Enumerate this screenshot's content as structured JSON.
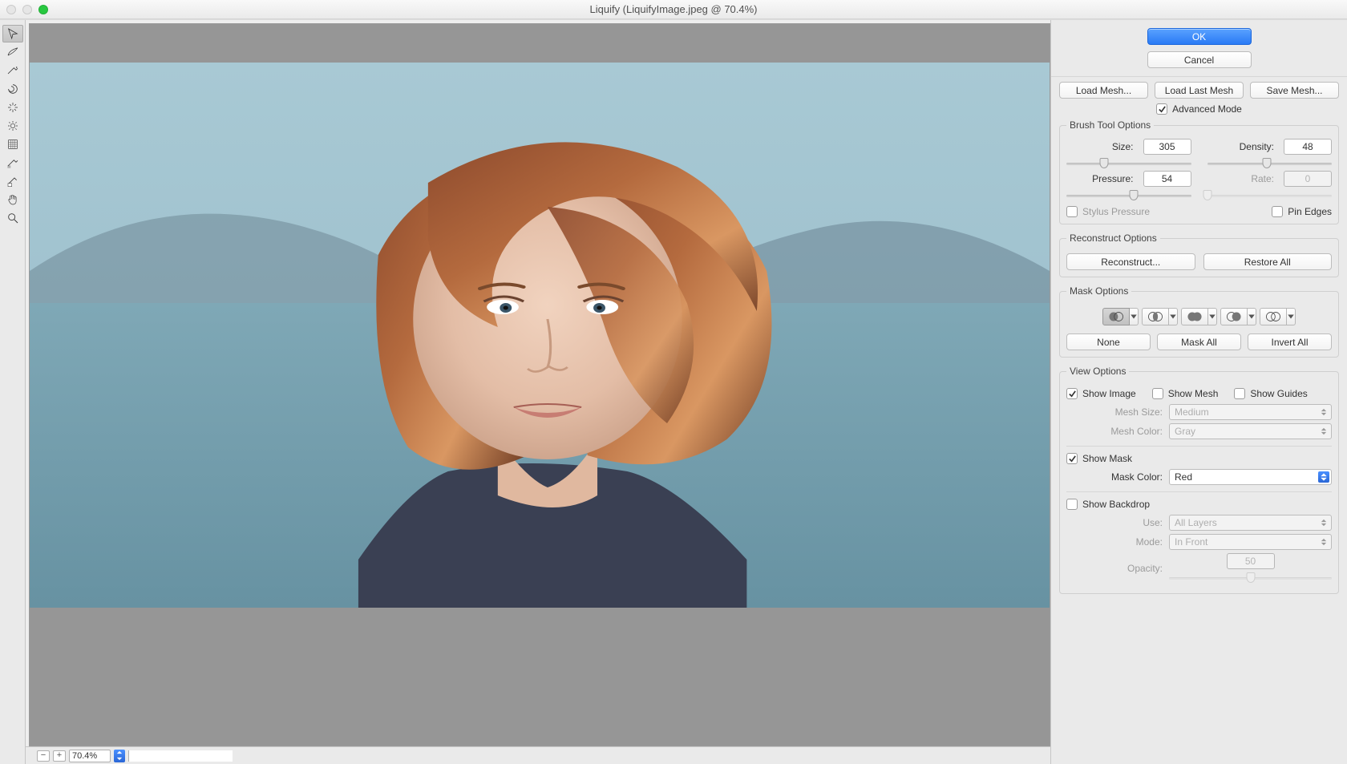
{
  "window": {
    "title": "Liquify (LiquifyImage.jpeg @ 70.4%)"
  },
  "tools": [
    {
      "name": "forward-warp",
      "sel": true
    },
    {
      "name": "reconstruct"
    },
    {
      "name": "smooth"
    },
    {
      "name": "twirl"
    },
    {
      "name": "pucker"
    },
    {
      "name": "bloat"
    },
    {
      "name": "push-left"
    },
    {
      "name": "freeze-mask"
    },
    {
      "name": "thaw-mask"
    },
    {
      "name": "hand"
    },
    {
      "name": "zoom"
    }
  ],
  "status": {
    "zoom": "70.4%"
  },
  "actions": {
    "ok": "OK",
    "cancel": "Cancel"
  },
  "mesh_buttons": {
    "load": "Load Mesh...",
    "load_last": "Load Last Mesh",
    "save": "Save Mesh..."
  },
  "advanced": {
    "label": "Advanced Mode",
    "checked": true
  },
  "brush": {
    "legend": "Brush Tool Options",
    "size": {
      "label": "Size:",
      "value": "305",
      "pct": 30
    },
    "density": {
      "label": "Density:",
      "value": "48",
      "pct": 48
    },
    "pressure": {
      "label": "Pressure:",
      "value": "54",
      "pct": 54
    },
    "rate": {
      "label": "Rate:",
      "value": "0",
      "pct": 0,
      "disabled": true
    },
    "stylus": {
      "label": "Stylus Pressure",
      "checked": false
    },
    "pin": {
      "label": "Pin Edges",
      "checked": false
    }
  },
  "reconstruct": {
    "legend": "Reconstruct Options",
    "reconstruct": "Reconstruct...",
    "restore": "Restore All"
  },
  "mask": {
    "legend": "Mask Options",
    "none": "None",
    "mask_all": "Mask All",
    "invert_all": "Invert All"
  },
  "view": {
    "legend": "View Options",
    "show_image": {
      "label": "Show Image",
      "checked": true
    },
    "show_mesh": {
      "label": "Show Mesh",
      "checked": false
    },
    "show_guides": {
      "label": "Show Guides",
      "checked": false
    },
    "mesh_size": {
      "label": "Mesh Size:",
      "value": "Medium"
    },
    "mesh_color": {
      "label": "Mesh Color:",
      "value": "Gray"
    },
    "show_mask": {
      "label": "Show Mask",
      "checked": true
    },
    "mask_color": {
      "label": "Mask Color:",
      "value": "Red"
    },
    "show_backdrop": {
      "label": "Show Backdrop",
      "checked": false
    },
    "use": {
      "label": "Use:",
      "value": "All Layers"
    },
    "mode": {
      "label": "Mode:",
      "value": "In Front"
    },
    "opacity": {
      "label": "Opacity:",
      "value": "50",
      "pct": 50
    }
  }
}
